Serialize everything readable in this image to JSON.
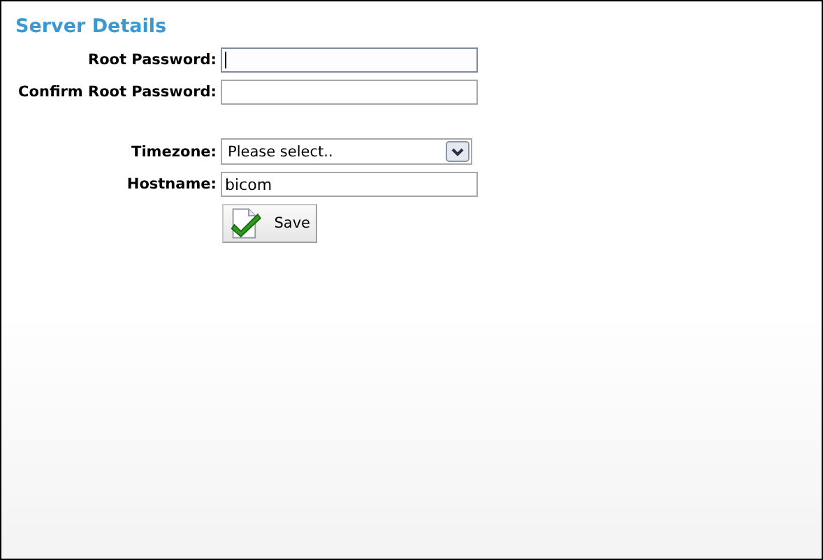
{
  "title": "Server Details",
  "fields": [
    {
      "kind": "password",
      "label": "Root Password:",
      "focused": true
    },
    {
      "kind": "password",
      "label": "Confirm Root Password:",
      "focused": false
    },
    {
      "kind": "spacer"
    },
    {
      "kind": "select",
      "label": "Timezone:",
      "value": "Please select.."
    },
    {
      "kind": "text",
      "label": "Hostname:",
      "value": "bicom",
      "focused": false
    }
  ],
  "save_button": "Save"
}
